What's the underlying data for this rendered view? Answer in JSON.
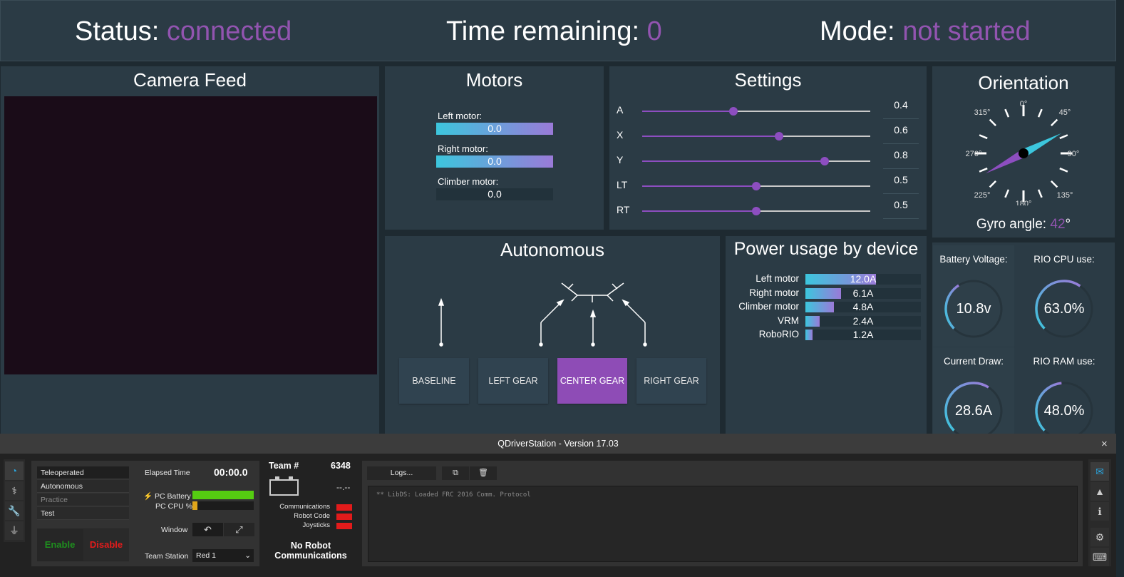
{
  "status": {
    "status_label": "Status:",
    "status_value": "connected",
    "time_label": "Time remaining:",
    "time_value": "0",
    "mode_label": "Mode:",
    "mode_value": "not started"
  },
  "camera": {
    "title": "Camera Feed"
  },
  "motors": {
    "title": "Motors",
    "items": [
      {
        "label": "Left motor:",
        "value": "0.0",
        "fraction": 1.0
      },
      {
        "label": "Right motor:",
        "value": "0.0",
        "fraction": 1.0
      },
      {
        "label": "Climber motor:",
        "value": "0.0",
        "fraction": 0
      }
    ]
  },
  "settings": {
    "title": "Settings",
    "items": [
      {
        "label": "A",
        "value": "0.4"
      },
      {
        "label": "X",
        "value": "0.6"
      },
      {
        "label": "Y",
        "value": "0.8"
      },
      {
        "label": "LT",
        "value": "0.5"
      },
      {
        "label": "RT",
        "value": "0.5"
      }
    ]
  },
  "orientation": {
    "title": "Orientation",
    "angle_labels": [
      "0°",
      "45°",
      "90°",
      "135°",
      "180°",
      "225°",
      "270°",
      "315°"
    ],
    "gyro_label": "Gyro angle:",
    "gyro_value": "42",
    "gyro_unit": "°",
    "gyro_angle_deg": 42
  },
  "autonomous": {
    "title": "Autonomous",
    "buttons": [
      {
        "label": "BASELINE",
        "selected": false
      },
      {
        "label": "LEFT GEAR",
        "selected": false
      },
      {
        "label": "CENTER GEAR",
        "selected": true
      },
      {
        "label": "RIGHT GEAR",
        "selected": false
      }
    ]
  },
  "power": {
    "title": "Power usage by device",
    "items": [
      {
        "label": "Left motor",
        "value": "12.0A",
        "amps": 12.0
      },
      {
        "label": "Right motor",
        "value": "6.1A",
        "amps": 6.1
      },
      {
        "label": "Climber motor",
        "value": "4.8A",
        "amps": 4.8
      },
      {
        "label": "VRM",
        "value": "2.4A",
        "amps": 2.4
      },
      {
        "label": "RoboRIO",
        "value": "1.2A",
        "amps": 1.2
      }
    ]
  },
  "gauges": [
    {
      "label": "Battery Voltage:",
      "value": "10.8v",
      "fraction": 0.38
    },
    {
      "label": "RIO CPU use:",
      "value": "63.0%",
      "fraction": 0.63
    },
    {
      "label": "Current Draw:",
      "value": "28.6A",
      "fraction": 0.62
    },
    {
      "label": "RIO RAM use:",
      "value": "48.0%",
      "fraction": 0.48
    }
  ],
  "ds": {
    "title": "QDriverStation - Version 17.03",
    "modes": [
      "Teleoperated",
      "Autonomous",
      "Practice",
      "Test"
    ],
    "enable": "Enable",
    "disable": "Disable",
    "elapsed_label": "Elapsed Time",
    "elapsed_value": "00:00.0",
    "battery_label": "PC Battery",
    "cpu_label": "PC CPU %",
    "battery_fraction": 1.0,
    "cpu_fraction": 0.05,
    "window_label": "Window",
    "team_station_label": "Team Station",
    "team_station_value": "Red 1",
    "team_label": "Team #",
    "team_value": "6348",
    "voltage": "--.--",
    "comm_label": "Communications",
    "code_label": "Robot Code",
    "joy_label": "Joysticks",
    "no_comm": "No Robot Communications",
    "logs_button": "Logs...",
    "console": "** LibDS: Loaded FRC 2016 Comm. Protocol",
    "close": "×",
    "colors": {
      "led": "#e21b1b",
      "battery": "#55cc11",
      "cpu": "#e0a61b"
    }
  }
}
